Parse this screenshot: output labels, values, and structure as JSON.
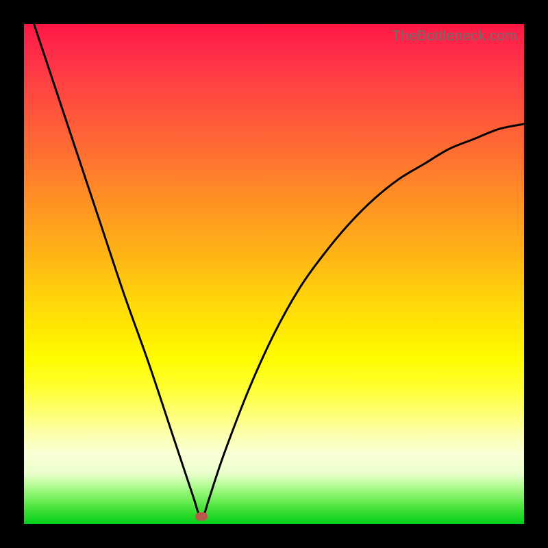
{
  "watermark": "TheBottleneck.com",
  "chart_data": {
    "type": "line",
    "title": "",
    "xlabel": "",
    "ylabel": "",
    "xlim": [
      0,
      100
    ],
    "ylim": [
      0,
      100
    ],
    "grid": false,
    "legend": false,
    "series": [
      {
        "name": "bottleneck-curve",
        "x": [
          2,
          5,
          10,
          15,
          20,
          25,
          30,
          32,
          34,
          35,
          36,
          37,
          40,
          45,
          50,
          55,
          60,
          65,
          70,
          75,
          80,
          85,
          90,
          95,
          100
        ],
        "y": [
          100,
          91,
          76,
          61,
          46,
          32,
          17,
          11,
          5,
          2,
          2,
          5,
          14,
          27,
          38,
          47,
          54,
          60,
          65,
          69,
          72,
          75,
          77,
          79,
          80
        ]
      }
    ],
    "marker": {
      "x": 35.5,
      "y": 1.5,
      "shape": "rounded-rect",
      "color": "#b85a4a"
    },
    "background_gradient": {
      "type": "vertical",
      "stops": [
        {
          "pos": 0.0,
          "color": "#ff1744"
        },
        {
          "pos": 0.67,
          "color": "#fffc00"
        },
        {
          "pos": 1.0,
          "color": "#00cf1b"
        }
      ]
    }
  }
}
